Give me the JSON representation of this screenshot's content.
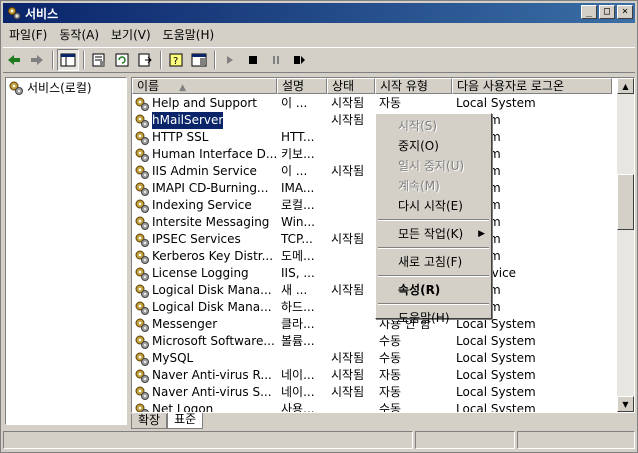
{
  "window": {
    "title": "서비스",
    "buttons": [
      "_",
      "□",
      "×"
    ]
  },
  "menu": [
    "파일(F)",
    "동작(A)",
    "보기(V)",
    "도움말(H)"
  ],
  "tree": {
    "root": "서비스(로컬)"
  },
  "columns": [
    "이름",
    "설명",
    "상태",
    "시작 유형",
    "다음 사용자로 로그온"
  ],
  "services": [
    {
      "name": "Help and Support",
      "desc": "이 ...",
      "status": "시작됨",
      "startup": "자동",
      "logon": "Local System"
    },
    {
      "name": "hMailServer",
      "desc": "",
      "status": "시작됨",
      "startup": "",
      "logon": "System",
      "selected": true
    },
    {
      "name": "HTTP SSL",
      "desc": "HTT...",
      "status": "",
      "startup": "",
      "logon": "System"
    },
    {
      "name": "Human Interface D...",
      "desc": "키보...",
      "status": "",
      "startup": "",
      "logon": "System"
    },
    {
      "name": "IIS Admin Service",
      "desc": "이 ...",
      "status": "시작됨",
      "startup": "",
      "logon": "System"
    },
    {
      "name": "IMAPI CD-Burning...",
      "desc": "IMA...",
      "status": "",
      "startup": "",
      "logon": "System"
    },
    {
      "name": "Indexing Service",
      "desc": "로컬...",
      "status": "",
      "startup": "",
      "logon": "System"
    },
    {
      "name": "Intersite Messaging",
      "desc": "Win...",
      "status": "",
      "startup": "",
      "logon": "System"
    },
    {
      "name": "IPSEC Services",
      "desc": "TCP...",
      "status": "시작됨",
      "startup": "",
      "logon": "System"
    },
    {
      "name": "Kerberos Key Distr...",
      "desc": "도메...",
      "status": "",
      "startup": "",
      "logon": "System"
    },
    {
      "name": "License Logging",
      "desc": "IIS, ...",
      "status": "",
      "startup": "",
      "logon": "rk Service"
    },
    {
      "name": "Logical Disk Mana...",
      "desc": "새 ...",
      "status": "시작됨",
      "startup": "",
      "logon": "System"
    },
    {
      "name": "Logical Disk Mana...",
      "desc": "하드...",
      "status": "",
      "startup": "",
      "logon": "System"
    },
    {
      "name": "Messenger",
      "desc": "클라...",
      "status": "",
      "startup": "사용 안 함",
      "logon": "Local System"
    },
    {
      "name": "Microsoft Software...",
      "desc": "볼륨...",
      "status": "",
      "startup": "수동",
      "logon": "Local System"
    },
    {
      "name": "MySQL",
      "desc": "",
      "status": "시작됨",
      "startup": "수동",
      "logon": "Local System"
    },
    {
      "name": "Naver Anti-virus R...",
      "desc": "네이...",
      "status": "시작됨",
      "startup": "자동",
      "logon": "Local System"
    },
    {
      "name": "Naver Anti-virus S...",
      "desc": "네이...",
      "status": "시작됨",
      "startup": "자동",
      "logon": "Local System"
    },
    {
      "name": "Net Logon",
      "desc": "사용...",
      "status": "",
      "startup": "수동",
      "logon": "Local System"
    }
  ],
  "context_menu": {
    "start": "시작(S)",
    "stop": "중지(O)",
    "pause": "일시 중지(U)",
    "resume": "계속(M)",
    "restart": "다시 시작(E)",
    "all_tasks": "모든 작업(K)",
    "refresh": "새로 고침(F)",
    "properties": "속성(R)",
    "help": "도움말(H)"
  },
  "tabs": [
    "확장",
    "표준"
  ],
  "colors": {
    "selection": "#0a246a",
    "title_gradient_start": "#0a246a",
    "title_gradient_end": "#3a6ea5"
  }
}
